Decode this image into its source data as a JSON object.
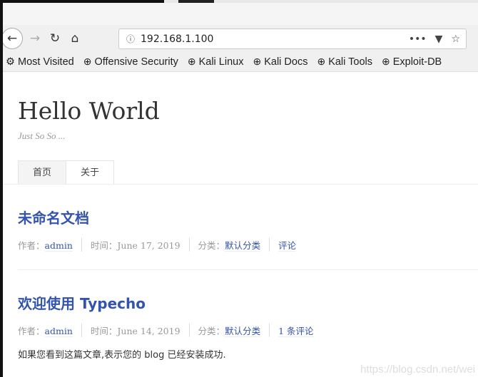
{
  "browser": {
    "url": "192.168.1.100",
    "bookmarks": [
      "Most Visited",
      "Offensive Security",
      "Kali Linux",
      "Kali Docs",
      "Kali Tools",
      "Exploit-DB"
    ]
  },
  "site": {
    "title": "Hello World",
    "description": "Just So So ...",
    "nav": [
      "首页",
      "关于"
    ]
  },
  "posts": [
    {
      "title": "未命名文档",
      "author_label": "作者：",
      "author": "admin",
      "time_label": "时间：",
      "time": "June 17, 2019",
      "category_label": "分类：",
      "category": "默认分类",
      "comments": "评论",
      "body": ""
    },
    {
      "title": "欢迎使用 Typecho",
      "author_label": "作者：",
      "author": "admin",
      "time_label": "时间：",
      "time": "June 14, 2019",
      "category_label": "分类：",
      "category": "默认分类",
      "comments": "1 条评论",
      "body": "如果您看到这篇文章,表示您的 blog 已经安装成功."
    }
  ],
  "watermark": "https://blog.csdn.net/wei"
}
